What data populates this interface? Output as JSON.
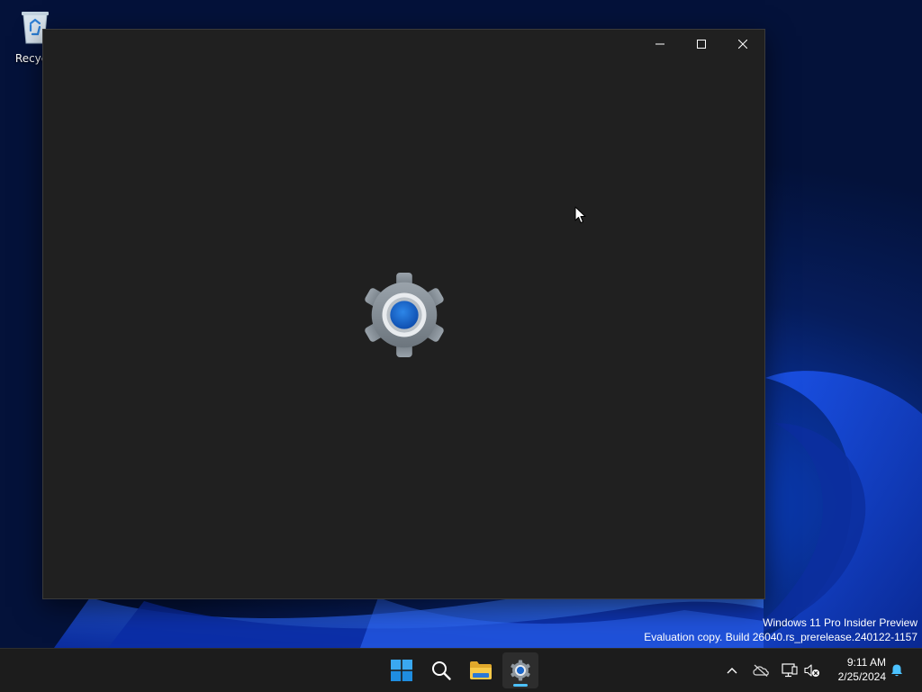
{
  "desktop": {
    "icons": [
      {
        "label": "Recycle",
        "icon": "recycle-bin-icon"
      }
    ]
  },
  "window": {
    "app": "Settings",
    "state": "loading-splash",
    "splash_icon": "gear-icon",
    "controls": [
      "minimize-icon",
      "maximize-icon",
      "close-icon"
    ]
  },
  "watermark": {
    "line1": "Windows 11 Pro Insider Preview",
    "line2": "Evaluation copy. Build 26040.rs_prerelease.240122-1157"
  },
  "taskbar": {
    "apps": [
      {
        "name": "start",
        "icon": "windows-logo-icon"
      },
      {
        "name": "search",
        "icon": "search-icon"
      },
      {
        "name": "file-explorer",
        "icon": "folder-icon"
      },
      {
        "name": "settings",
        "icon": "gear-icon",
        "active": true
      }
    ],
    "tray": {
      "icons": [
        "chevron-up-icon",
        "onedrive-icon",
        "network-icon",
        "speaker-muted-icon",
        "notification-bell-icon"
      ]
    },
    "clock": {
      "time": "9:11 AM",
      "date": "2/25/2024"
    }
  },
  "colors": {
    "window_bg": "#202020",
    "taskbar_bg": "#1c1c1c",
    "accent": "#4cc2ff",
    "gear_blue": "#1a66c9"
  }
}
